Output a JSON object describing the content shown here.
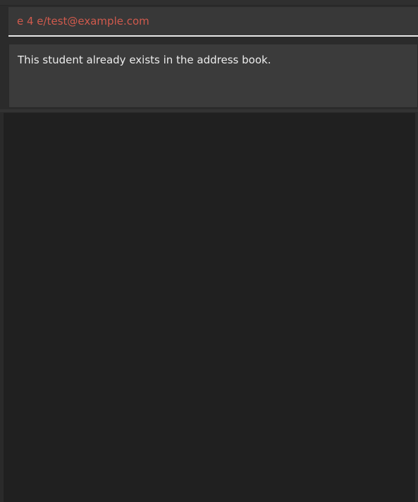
{
  "command_box": {
    "value": "e 4 e/test@example.com"
  },
  "result_display": {
    "message": "This student already exists in the address book."
  },
  "colors": {
    "command_error_text": "#d05a4d",
    "result_text": "#ececec",
    "panel_background": "#3b3b3b",
    "list_background": "#202020"
  }
}
